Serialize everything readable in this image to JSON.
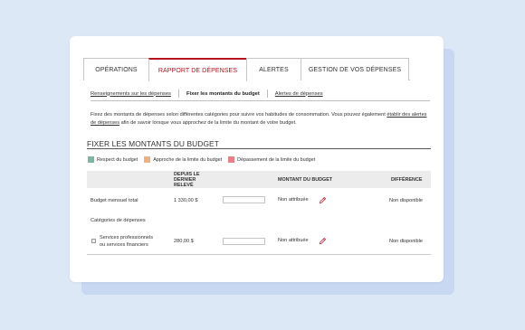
{
  "tabs": [
    {
      "label": "OPÉRATIONS",
      "active": false
    },
    {
      "label": "RAPPORT DE DÉPENSES",
      "active": true
    },
    {
      "label": "ALERTES",
      "active": false
    },
    {
      "label": "GESTION DE VOS DÉPENSES",
      "active": false
    }
  ],
  "subnav": {
    "item1": "Renseignements sur les dépenses",
    "item2": "Fixer les montants du budget",
    "item3": "Alertes de dépenses"
  },
  "description": {
    "text1": "Fixez des montants de dépenses selon différentes catégories pour suivre vos habitudes de consommation. Vous pouvez également ",
    "link": "établir des alertes de dépenses",
    "text2": " afin de savoir lorsque vous approchez de la limite du montant de votre budget."
  },
  "section_title": "FIXER LES MONTANTS DU BUDGET",
  "legend": [
    {
      "label": "Respect du budget",
      "color": "#7fb5a6"
    },
    {
      "label": "Approche de la limite du budget",
      "color": "#f0b27a"
    },
    {
      "label": "Dépassement de la limite du budget",
      "color": "#e8808a"
    }
  ],
  "table": {
    "headers": {
      "since_line1": "DEPUIS LE",
      "since_line2": "DERNIER",
      "since_line3": "RELEVÉ",
      "budget": "MONTANT DU BUDGET",
      "difference": "DIFFÉRENCE"
    },
    "rows": {
      "total": {
        "label": "Budget mensuel total",
        "amount": "1 330,00 $",
        "status": "Non attribuée",
        "difference": "Non disponible"
      },
      "categories_label": "Catégories de dépenses",
      "services": {
        "label_line1": "Services professionnels",
        "label_line2": "ou services financiers",
        "amount": "280,00 $",
        "status": "Non attribuée",
        "difference": "Non disponible"
      }
    }
  },
  "colors": {
    "accent": "#b5121b",
    "pencil": "#c9344a"
  },
  "icons": {
    "edit": "pencil-icon",
    "checkbox": "checkbox"
  }
}
